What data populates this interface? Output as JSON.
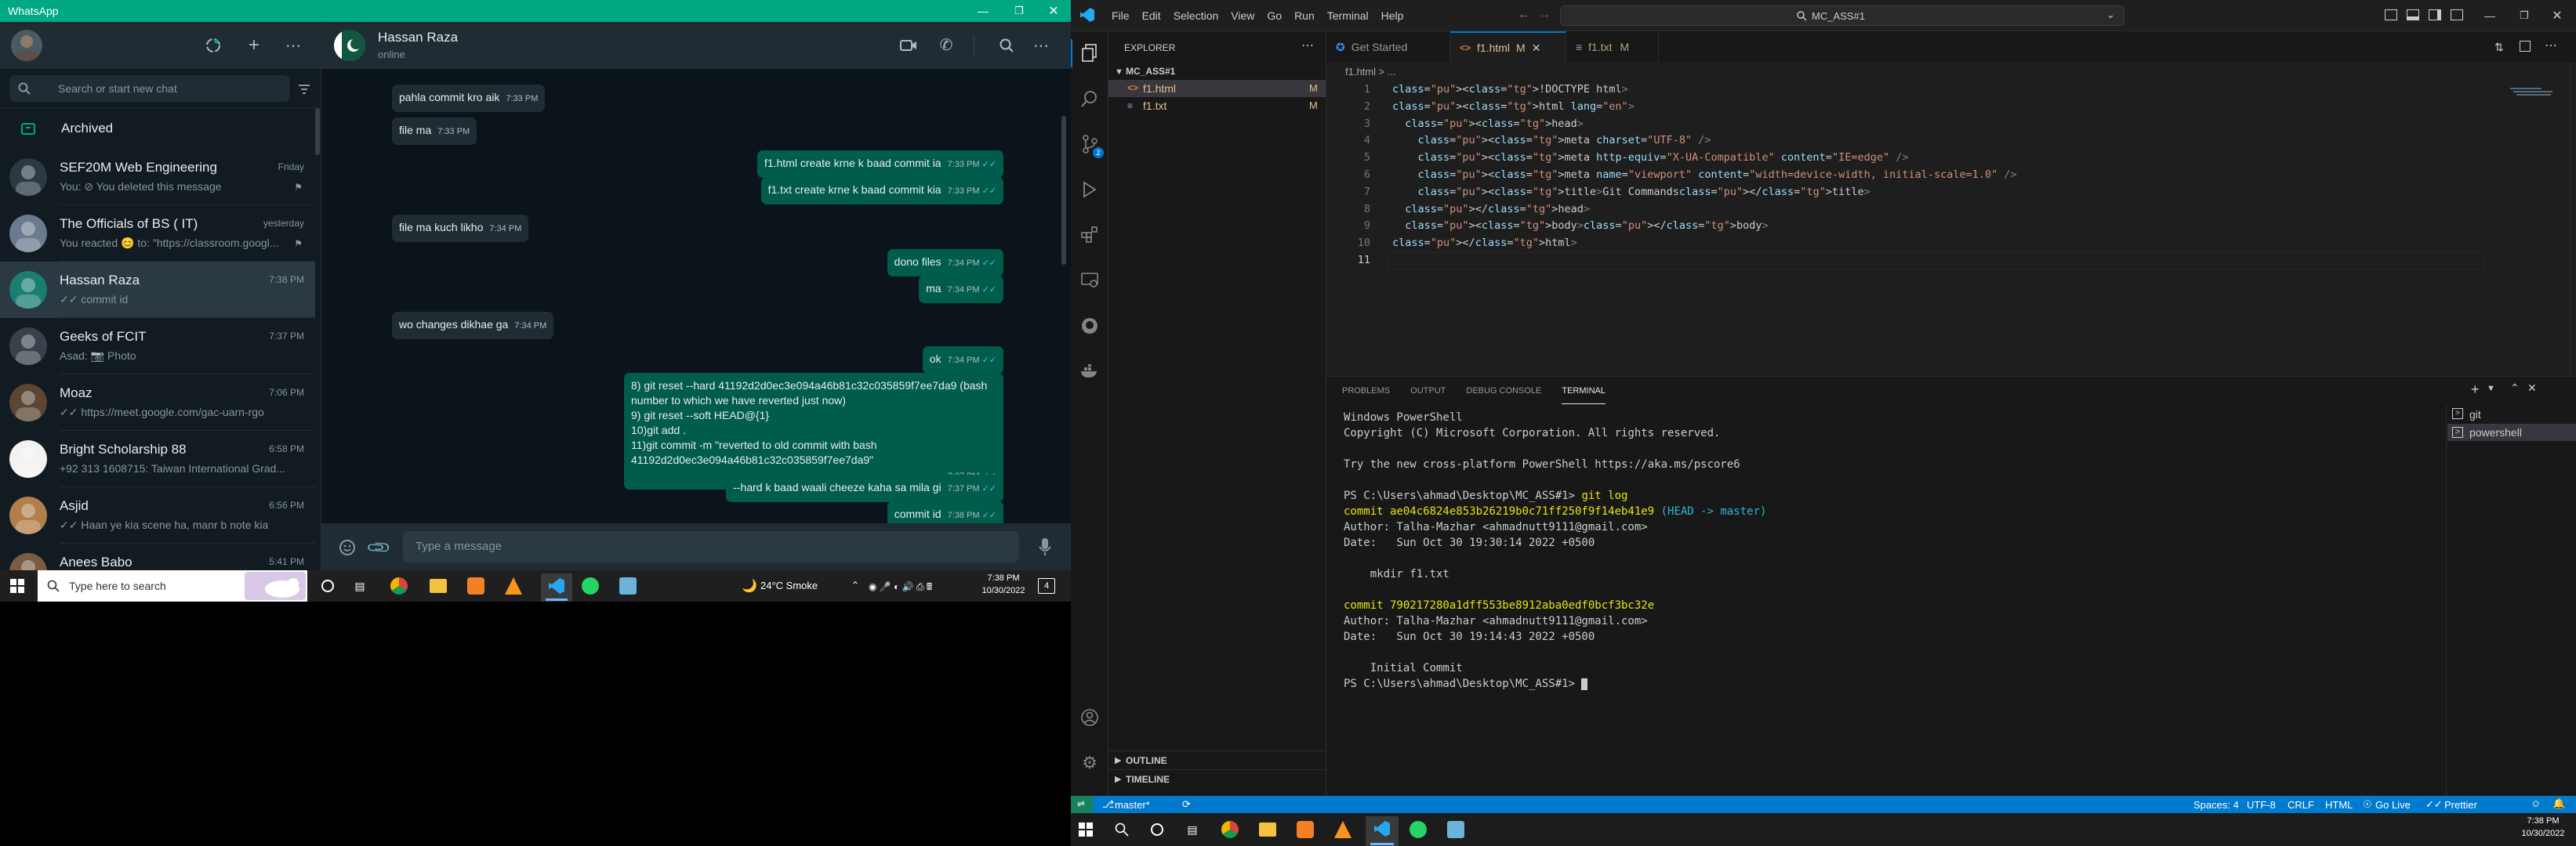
{
  "whatsapp": {
    "title": "WhatsApp",
    "search_placeholder": "Search or start new chat",
    "archived": "Archived",
    "chats": [
      {
        "name": "SEF20M Web Engineering",
        "time": "Friday",
        "preview": "You: ⊘ You deleted this message",
        "color": "#2a3942"
      },
      {
        "name": "The Officials of BS ( IT)",
        "time": "yesterday",
        "preview": "You reacted 😊 to: \"https://classroom.googl...",
        "color": "#6b7a8f"
      },
      {
        "name": "Hassan Raza",
        "time": "7:38 PM",
        "preview": "✓✓ commit id",
        "color": "#1a7f72"
      },
      {
        "name": "Geeks of FCIT",
        "time": "7:37 PM",
        "preview": "Asad: 📷 Photo",
        "color": "#39424a"
      },
      {
        "name": "Moaz",
        "time": "7:06 PM",
        "preview": "✓✓ https://meet.google.com/gac-uarn-rgo",
        "color": "#5a4632"
      },
      {
        "name": "Bright Scholarship 88",
        "time": "6:58 PM",
        "preview": "+92 313 1608715: Taiwan International Grad...",
        "color": "#f2f2f2"
      },
      {
        "name": "Asjid",
        "time": "6:56 PM",
        "preview": "✓✓ Haan ye kia scene ha, manr b note kia",
        "color": "#b07f4a"
      },
      {
        "name": "Anees Babo",
        "time": "5:41 PM",
        "preview": "",
        "color": "#7a5c44"
      }
    ],
    "header": {
      "name": "Hassan Raza",
      "status": "online"
    },
    "messages": [
      {
        "dir": "in",
        "text": "pahla commit kro aik",
        "time": "7:33 PM"
      },
      {
        "dir": "in",
        "text": "file ma",
        "time": "7:33 PM"
      },
      {
        "dir": "out",
        "text": "f1.html create krne k baad commit ia",
        "time": "7:33 PM"
      },
      {
        "dir": "out",
        "text": "f1.txt create krne k baad commit kia",
        "time": "7:33 PM"
      },
      {
        "dir": "in",
        "text": "file ma kuch likho",
        "time": "7:34 PM"
      },
      {
        "dir": "out",
        "text": "dono files",
        "time": "7:34 PM"
      },
      {
        "dir": "out",
        "text": "ma",
        "time": "7:34 PM"
      },
      {
        "dir": "in",
        "text": "wo changes dikhae ga",
        "time": "7:34 PM"
      },
      {
        "dir": "out",
        "text": "ok",
        "time": "7:34 PM"
      },
      {
        "dir": "out",
        "lines": [
          "8) git reset --hard  41192d2d0ec3e094a46b81c32c035859f7ee7da9 (bash",
          "number to which we have reverted just now)",
          "9) git reset --soft HEAD@{1}",
          "10)git add .",
          "11)git commit -m \"reverted to old commit with bash",
          "41192d2d0ec3e094a46b81c32c035859f7ee7da9\""
        ],
        "time": "7:37 PM"
      },
      {
        "dir": "out",
        "text": "--hard k baad waali cheeze kaha sa mila gi",
        "time": "7:37 PM"
      },
      {
        "dir": "out",
        "text": "commit id",
        "time": "7:38 PM"
      }
    ],
    "compose_placeholder": "Type a message"
  },
  "taskbar_small": {
    "search": "Type here to search",
    "weather": "24°C  Smoke",
    "time": "7:38 PM",
    "date": "10/30/2022"
  },
  "vscode": {
    "menu": [
      "File",
      "Edit",
      "Selection",
      "View",
      "Go",
      "Run",
      "Terminal",
      "Help"
    ],
    "command_center": "MC_ASS#1",
    "explorer_title": "EXPLORER",
    "folder": "MC_ASS#1",
    "files": [
      {
        "name": "f1.html",
        "badge": "M"
      },
      {
        "name": "f1.txt",
        "badge": "M"
      }
    ],
    "tabs": [
      {
        "name": "Get Started",
        "badge": ""
      },
      {
        "name": "f1.html",
        "badge": "M"
      },
      {
        "name": "f1.txt",
        "badge": "M"
      }
    ],
    "breadcrumb": "f1.html > ...",
    "line_numbers": [
      "1",
      "2",
      "3",
      "4",
      "5",
      "6",
      "7",
      "8",
      "9",
      "10",
      "11"
    ],
    "code": [
      "<!DOCTYPE html>",
      "<html lang=\"en\">",
      "  <head>",
      "    <meta charset=\"UTF-8\" />",
      "    <meta http-equiv=\"X-UA-Compatible\" content=\"IE=edge\" />",
      "    <meta name=\"viewport\" content=\"width=device-width, initial-scale=1.0\" />",
      "    <title>Git Commands</title>",
      "  </head>",
      "  <body></body>",
      "</html>",
      ""
    ],
    "panel_tabs": [
      "PROBLEMS",
      "OUTPUT",
      "DEBUG CONSOLE",
      "TERMINAL"
    ],
    "terminal": {
      "l1": "Windows PowerShell",
      "l2": "Copyright (C) Microsoft Corporation. All rights reserved.",
      "l3": "Try the new cross-platform PowerShell https://aka.ms/pscore6",
      "prompt": "PS C:\\Users\\ahmad\\Desktop\\MC_ASS#1> ",
      "cmd": "git log",
      "c1": "commit ae04c6824e853b26219b0c71ff250f9f14eb41e9",
      "c1_ref": " (HEAD -> master)",
      "a1": "Author: Talha-Mazhar <ahmadnutt9111@gmail.com>",
      "d1": "Date:   Sun Oct 30 19:30:14 2022 +0500",
      "m1": "    mkdir f1.txt",
      "c2": "commit 790217280a1dff553be8912aba0edf0bcf3bc32e",
      "a2": "Author: Talha-Mazhar <ahmadnutt9111@gmail.com>",
      "d2": "Date:   Sun Oct 30 19:14:43 2022 +0500",
      "m2": "    Initial Commit",
      "prompt2": "PS C:\\Users\\ahmad\\Desktop\\MC_ASS#1> "
    },
    "terminal_list": [
      "git",
      "powershell"
    ],
    "outline": "OUTLINE",
    "timeline": "TIMELINE",
    "status": {
      "branch": "master*",
      "spaces": "Spaces: 4",
      "encoding": "UTF-8",
      "eol": "CRLF",
      "lang": "HTML",
      "live": "Go Live",
      "prettier": "Prettier"
    },
    "taskbar_time": "7:38 PM",
    "taskbar_date": "10/30/2022"
  }
}
